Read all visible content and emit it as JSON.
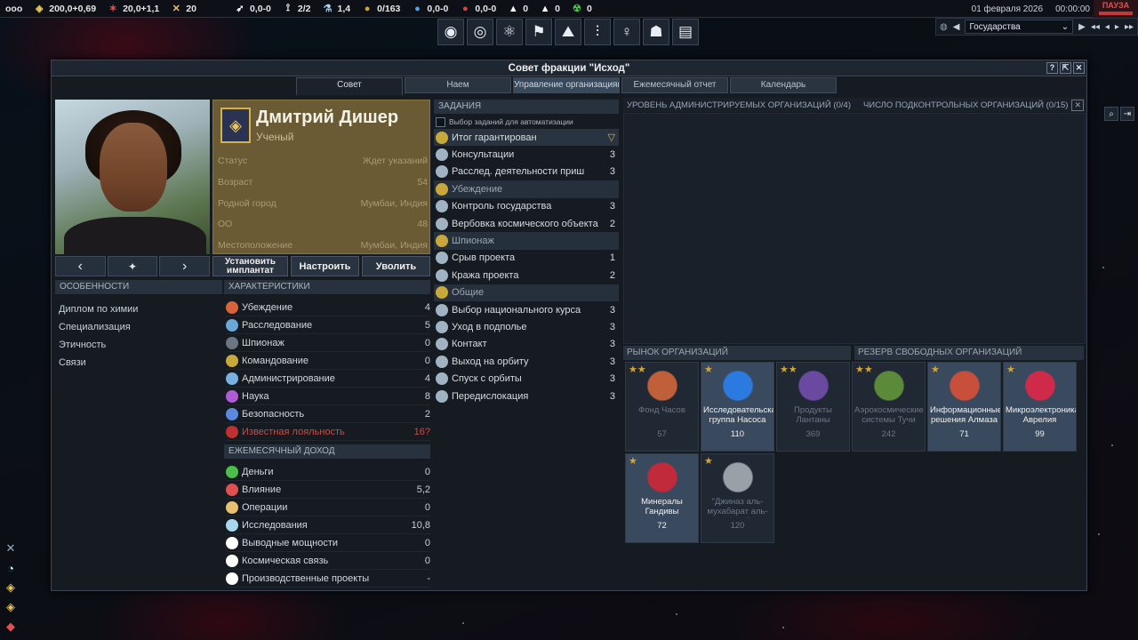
{
  "topbar": {
    "menu_icon": "ooo",
    "resources": [
      {
        "icon": "faction-emblem-icon",
        "value": "200,0+0,69",
        "color": "#e9c55a"
      },
      {
        "icon": "influence-icon",
        "value": "20,0+1,1",
        "color": "#e05050"
      },
      {
        "icon": "operations-icon",
        "value": "20",
        "color": "#e8c070"
      },
      {
        "icon": "boost-icon",
        "value": "0,0-0",
        "color": "#ffffff"
      },
      {
        "icon": "mission-control-icon",
        "value": "2/2",
        "color": "#ffffff"
      },
      {
        "icon": "research-icon",
        "value": "1,4",
        "color": "#a8d8f0"
      },
      {
        "icon": "gold-icon",
        "value": "0/163",
        "color": "#d6a531"
      },
      {
        "icon": "water-icon",
        "value": "0,0-0",
        "color": "#4aa8e8"
      },
      {
        "icon": "volatiles-icon",
        "value": "0,0-0",
        "color": "#e04040"
      },
      {
        "icon": "metals-icon",
        "value": "0",
        "color": "#ffffff"
      },
      {
        "icon": "nobles-icon",
        "value": "0",
        "color": "#ffffff"
      },
      {
        "icon": "fissiles-icon",
        "value": "0",
        "color": "#4ac04a"
      }
    ],
    "date": "01 февраля 2026",
    "time": "00:00:00",
    "pause": "ПАУЗА"
  },
  "time_controls": {
    "view_selected": "Государства"
  },
  "window": {
    "title": "Совет фракции \"Исход\"",
    "tabs": [
      "Совет",
      "Наем",
      "Управление организациями",
      "Ежемесячный отчет",
      "Календарь"
    ],
    "active_tab": "Совет"
  },
  "councilor": {
    "name": "Дмитрий Дишер",
    "role": "Ученый",
    "rows": [
      {
        "label": "Статус",
        "value": "Ждет указаний"
      },
      {
        "label": "Возраст",
        "value": "54"
      },
      {
        "label": "Родной город",
        "value": "Мумбаи, Индия"
      },
      {
        "label": "ОО",
        "value": "48"
      },
      {
        "label": "Местоположение",
        "value": "Мумбаи, Индия"
      }
    ],
    "buttons": {
      "implant": "Установить имплантат",
      "configure": "Настроить",
      "fire": "Уволить"
    }
  },
  "traits": {
    "header": "ОСОБЕННОСТИ",
    "items": [
      "Диплом по химии",
      "Специализация",
      "Этичность",
      "Связи"
    ]
  },
  "stats": {
    "header": "ХАРАКТЕРИСТИКИ",
    "items": [
      {
        "label": "Убеждение",
        "value": "4",
        "color": "#d9633a"
      },
      {
        "label": "Расследование",
        "value": "5",
        "color": "#6aa8d8"
      },
      {
        "label": "Шпионаж",
        "value": "0",
        "color": "#6c7682"
      },
      {
        "label": "Командование",
        "value": "0",
        "color": "#c8a83a"
      },
      {
        "label": "Администрирование",
        "value": "4",
        "color": "#7ab0e0"
      },
      {
        "label": "Наука",
        "value": "8",
        "color": "#b05ad8"
      },
      {
        "label": "Безопасность",
        "value": "2",
        "color": "#5a8ae0"
      },
      {
        "label": "Известная лояльность",
        "value": "16?",
        "color": "#c03030"
      }
    ]
  },
  "income": {
    "header": "ЕЖЕМЕСЯЧНЫЙ ДОХОД",
    "items": [
      {
        "label": "Деньги",
        "value": "0",
        "color": "#4ac04a"
      },
      {
        "label": "Влияние",
        "value": "5,2",
        "color": "#e05050"
      },
      {
        "label": "Операции",
        "value": "0",
        "color": "#e8c070"
      },
      {
        "label": "Исследования",
        "value": "10,8",
        "color": "#a8d8f0"
      },
      {
        "label": "Выводные мощности",
        "value": "0",
        "color": "#ffffff"
      },
      {
        "label": "Космическая связь",
        "value": "0",
        "color": "#ffffff"
      },
      {
        "label": "Производственные проекты",
        "value": "-",
        "color": "#ffffff"
      }
    ]
  },
  "missions": {
    "header": "ЗАДАНИЯ",
    "auto_label": "Выбор заданий для автоматизации",
    "rows": [
      {
        "label": "Итог гарантирован",
        "value": "▽",
        "type": "hl"
      },
      {
        "label": "Консультации",
        "value": "3",
        "type": "task"
      },
      {
        "label": "Расслед. деятельности приш",
        "value": "3",
        "type": "task"
      },
      {
        "label": "Убеждение",
        "value": "",
        "type": "cat"
      },
      {
        "label": "Контроль государства",
        "value": "3",
        "type": "task"
      },
      {
        "label": "Вербовка космического объекта",
        "value": "2",
        "type": "task"
      },
      {
        "label": "Шпионаж",
        "value": "",
        "type": "cat"
      },
      {
        "label": "Срыв проекта",
        "value": "1",
        "type": "task"
      },
      {
        "label": "Кража проекта",
        "value": "2",
        "type": "task"
      },
      {
        "label": "Общие",
        "value": "",
        "type": "cat"
      },
      {
        "label": "Выбор национального курса",
        "value": "3",
        "type": "task"
      },
      {
        "label": "Уход в подполье",
        "value": "3",
        "type": "task"
      },
      {
        "label": "Контакт",
        "value": "3",
        "type": "task"
      },
      {
        "label": "Выход на орбиту",
        "value": "3",
        "type": "task"
      },
      {
        "label": "Спуск с орбиты",
        "value": "3",
        "type": "task"
      },
      {
        "label": "Передислокация",
        "value": "3",
        "type": "task"
      }
    ]
  },
  "org_panel": {
    "admin_level": "УРОВЕНЬ АДМИНИСТРИРУЕМЫХ ОРГАНИЗАЦИЙ (0/4)",
    "controlled": "ЧИСЛО ПОДКОНТРОЛЬНЫХ ОРГАНИЗАЦИЙ (0/15)",
    "market_header": "РЫНОК ОРГАНИЗАЦИЙ",
    "reserve_header": "РЕЗЕРВ СВОБОДНЫХ ОРГАНИЗАЦИЙ"
  },
  "orgs": [
    {
      "stars": "★★",
      "name": "Фонд Часов",
      "cost": "57",
      "bright": false,
      "color": "#c0603a"
    },
    {
      "stars": "★",
      "name": "Исследовательская группа Насоса",
      "cost": "110",
      "bright": true,
      "color": "#2a7ae0"
    },
    {
      "stars": "★★",
      "name": "Продукты Лантаны",
      "cost": "369",
      "bright": false,
      "color": "#6a4aa0"
    },
    {
      "stars": "★★",
      "name": "Аэрокосмические системы Тучи",
      "cost": "242",
      "bright": false,
      "color": "#5a8a3a"
    },
    {
      "stars": "★",
      "name": "Информационные решения Алмаза",
      "cost": "71",
      "bright": true,
      "color": "#c8503a"
    },
    {
      "stars": "★",
      "name": "Микроэлектроника Аврелия",
      "cost": "99",
      "bright": true,
      "color": "#d02a4a"
    },
    {
      "stars": "★",
      "name": "Минералы Гандивы",
      "cost": "72",
      "bright": true,
      "color": "#c02a3a"
    },
    {
      "stars": "★",
      "name": "\"Джиназ аль-мухабарат аль-амма\"",
      "cost": "120",
      "bright": false,
      "color": "#9aa0a8"
    }
  ]
}
